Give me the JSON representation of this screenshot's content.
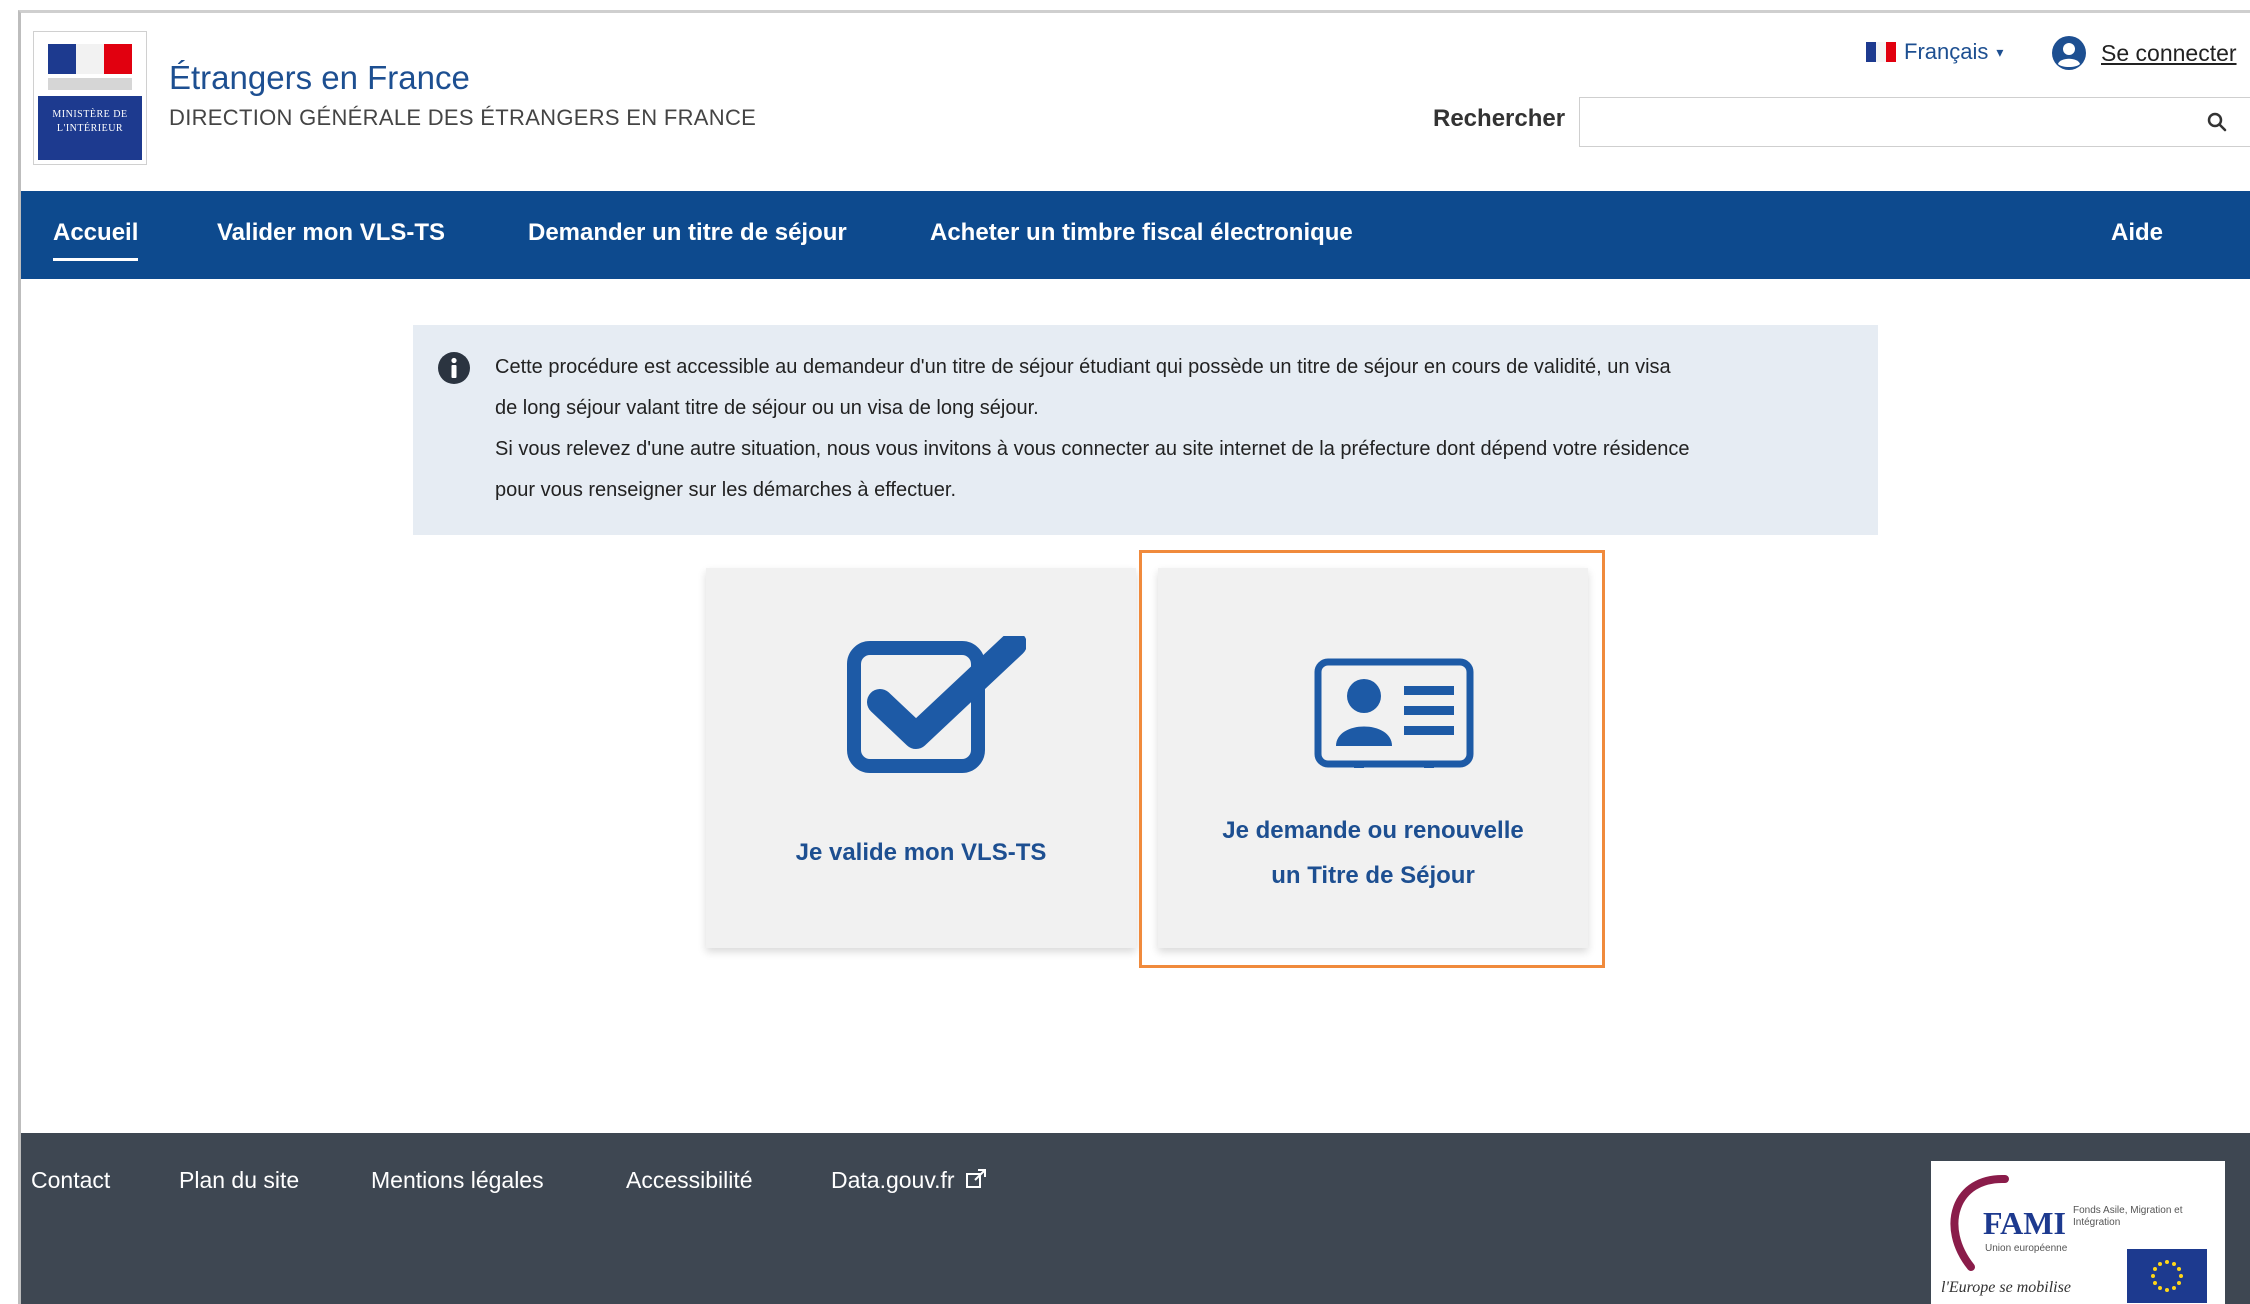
{
  "header": {
    "ministry_logo": "MINISTÈRE DE L'INTÉRIEUR",
    "site_title": "Étrangers en France",
    "site_subtitle": "DIRECTION GÉNÉRALE DES ÉTRANGERS EN FRANCE",
    "language": "Français",
    "connect_label": "Se connecter",
    "search_label": "Rechercher",
    "search_value": ""
  },
  "nav": {
    "items": [
      {
        "label": "Accueil",
        "active": true
      },
      {
        "label": "Valider mon VLS-TS"
      },
      {
        "label": "Demander un titre de séjour"
      },
      {
        "label": "Acheter un timbre fiscal électronique"
      },
      {
        "label": "Aide"
      }
    ]
  },
  "info": {
    "lines": [
      "Cette procédure est accessible au demandeur d'un titre de séjour étudiant qui possède un titre de séjour en cours de validité, un visa",
      "de long séjour valant titre de séjour ou un visa de long séjour.",
      "Si vous relevez d'une autre situation, nous vous invitons à vous connecter au site internet de la préfecture dont dépend votre résidence",
      "pour vous renseigner sur les démarches à effectuer."
    ]
  },
  "cards": [
    {
      "line1": "Je valide mon VLS-TS",
      "icon": "checkbox-check-icon"
    },
    {
      "line1": "Je demande ou renouvelle",
      "line2": "un Titre de Séjour",
      "icon": "id-card-icon",
      "selected": true
    }
  ],
  "footer": {
    "links": [
      "Contact",
      "Plan du site",
      "Mentions légales",
      "Accessibilité",
      "Data.gouv.fr"
    ],
    "fami_title": "FAMI",
    "fami_subtitle": "Fonds Asile, Migration et Intégration",
    "fami_eu": "Union européenne",
    "fami_motto": "l'Europe se mobilise"
  },
  "colors": {
    "brand_blue": "#0d4a8e",
    "link_blue": "#1d4f91",
    "footer_bg": "#3e4752",
    "info_bg": "#e6ecf3",
    "selection_outline": "#f08a3c"
  }
}
